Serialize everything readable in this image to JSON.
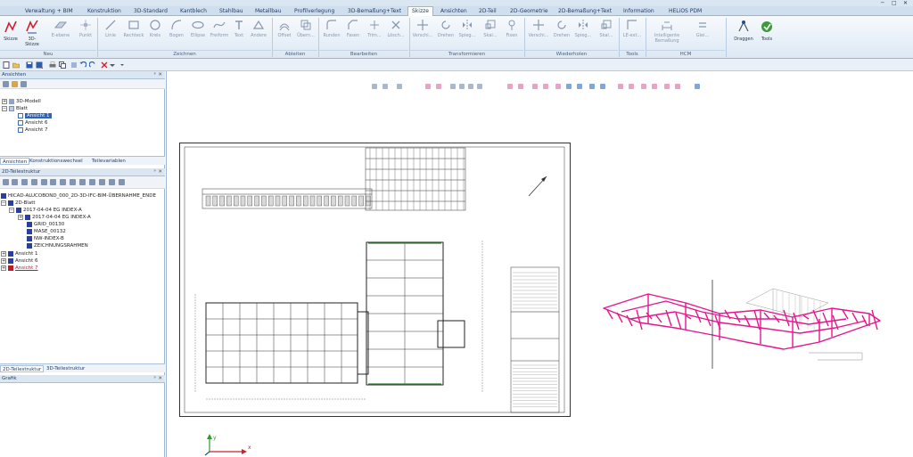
{
  "window": {
    "controls": [
      "─",
      "□",
      "✕"
    ]
  },
  "ribbon_tabs": [
    {
      "label": "Verwaltung + BIM"
    },
    {
      "label": "Konstruktion"
    },
    {
      "label": "3D-Standard"
    },
    {
      "label": "Kantblech"
    },
    {
      "label": "Stahlbau"
    },
    {
      "label": "Metallbau"
    },
    {
      "label": "Profilverlegung"
    },
    {
      "label": "3D-Bemaßung+Text"
    },
    {
      "label": "Skizze",
      "active": true
    },
    {
      "label": "Ansichten"
    },
    {
      "label": "2D-Teil"
    },
    {
      "label": "2D-Geometrie"
    },
    {
      "label": "2D-Bemaßung+Text"
    },
    {
      "label": "Information"
    },
    {
      "label": "HELiOS PDM"
    }
  ],
  "ribbon_buttons": [
    {
      "label": "Skizze",
      "icon": "skizze-icon"
    },
    {
      "label": "3D-Skizze",
      "icon": "3d-skizze-icon"
    },
    {
      "label": "E-ebene",
      "icon": "ebene-icon"
    },
    {
      "label": "Punkt",
      "icon": "punkt-icon"
    },
    {
      "label": "Linie",
      "icon": "linie-icon"
    },
    {
      "label": "Rechteck",
      "icon": "rechteck-icon"
    },
    {
      "label": "Kreis",
      "icon": "kreis-icon"
    },
    {
      "label": "Bogen",
      "icon": "bogen-icon"
    },
    {
      "label": "Ellipse",
      "icon": "ellipse-icon"
    },
    {
      "label": "Freiform",
      "icon": "freiform-icon"
    },
    {
      "label": "Text",
      "icon": "text-icon"
    },
    {
      "label": "Andere",
      "icon": "andere-icon"
    },
    {
      "label": "Offset",
      "icon": "offset-icon"
    },
    {
      "label": "Übern...",
      "icon": "uebernehmen-icon"
    },
    {
      "label": "Runden",
      "icon": "runden-icon"
    },
    {
      "label": "Fasen",
      "icon": "fasen-icon"
    },
    {
      "label": "Trim...",
      "icon": "trimmen-icon"
    },
    {
      "label": "Lösch...",
      "icon": "loeschen-icon"
    },
    {
      "label": "Verschi...",
      "icon": "verschieben-icon"
    },
    {
      "label": "Drehen",
      "icon": "drehen-icon"
    },
    {
      "label": "Spieg...",
      "icon": "spiegeln-icon"
    },
    {
      "label": "Skal...",
      "icon": "skalieren-icon"
    },
    {
      "label": "Fixen",
      "icon": "fixen-icon"
    },
    {
      "label": "Verschi...",
      "icon": "verschieben2-icon"
    },
    {
      "label": "Drehen",
      "icon": "drehen2-icon"
    },
    {
      "label": "Spieg...",
      "icon": "spiegeln2-icon"
    },
    {
      "label": "Skal...",
      "icon": "skalieren2-icon"
    },
    {
      "label": "LE-ext...",
      "icon": "le-ext-icon"
    },
    {
      "label": "Intelligente Bemaßung",
      "icon": "bemassung-icon"
    },
    {
      "label": "Glei...",
      "icon": "gleich-icon"
    },
    {
      "label": "Draggen",
      "icon": "draggen-icon"
    },
    {
      "label": "Tools",
      "icon": "tools-icon"
    }
  ],
  "ribbon_groups": [
    "Neu",
    "Zeichnen",
    "Ableiten",
    "Bearbeiten",
    "Transformieren",
    "Wiederholen",
    "Tools",
    "HCM"
  ],
  "ansichten_panel": {
    "title": "Ansichten",
    "items": [
      {
        "label": "3D-Modell"
      },
      {
        "label": "Blatt"
      },
      {
        "label": "Ansicht 1",
        "selected": true
      },
      {
        "label": "Ansicht 6"
      },
      {
        "label": "Ansicht 7"
      }
    ],
    "tabs": [
      "Ansichten",
      "Konstruktionswechsel",
      "Teilevariablen"
    ]
  },
  "teilestruktur_panel": {
    "title": "2D-Teilestruktur",
    "items": [
      {
        "label": "HICAD-ALUCOBOND_000_2D-3D-IFC-BIM-ÜBERNAHME_ENDE"
      },
      {
        "label": "2D-Blatt"
      },
      {
        "label": "2017-04-04 EG INDEX-A"
      },
      {
        "label": "2017-04-04 EG INDEX-A"
      },
      {
        "label": "GRID_00130"
      },
      {
        "label": "MASE_00132"
      },
      {
        "label": "NW-INDEX-B"
      },
      {
        "label": "ZEICHNUNGSRAHMEN"
      },
      {
        "label": "Ansicht 1"
      },
      {
        "label": "Ansicht 6"
      },
      {
        "label": "Ansicht 7",
        "red": true
      }
    ],
    "tabs": [
      "2D-Teilestruktur",
      "3D-Teilestruktur"
    ]
  },
  "grafik_panel": {
    "title": "Grafik"
  },
  "axis": {
    "x": "x",
    "y": "y"
  },
  "colors": {
    "accent": "#2f63b8",
    "model": "#e6168f",
    "ribbon": "#dbe6f3"
  }
}
